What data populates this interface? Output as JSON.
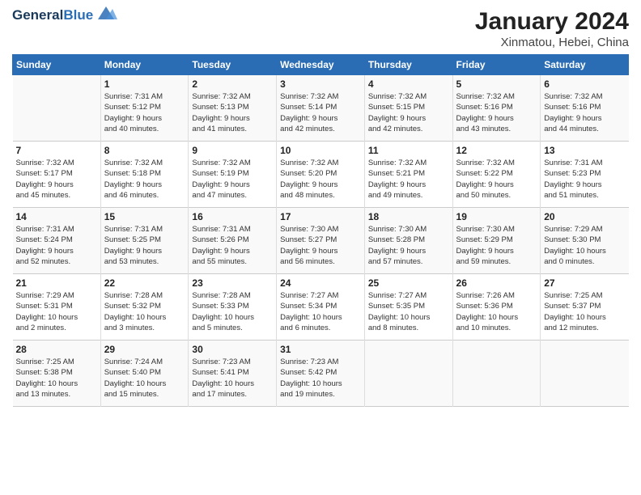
{
  "header": {
    "logo_line1": "General",
    "logo_line2": "Blue",
    "title": "January 2024",
    "subtitle": "Xinmatou, Hebei, China"
  },
  "columns": [
    "Sunday",
    "Monday",
    "Tuesday",
    "Wednesday",
    "Thursday",
    "Friday",
    "Saturday"
  ],
  "weeks": [
    [
      {
        "day": "",
        "info": ""
      },
      {
        "day": "1",
        "info": "Sunrise: 7:31 AM\nSunset: 5:12 PM\nDaylight: 9 hours\nand 40 minutes."
      },
      {
        "day": "2",
        "info": "Sunrise: 7:32 AM\nSunset: 5:13 PM\nDaylight: 9 hours\nand 41 minutes."
      },
      {
        "day": "3",
        "info": "Sunrise: 7:32 AM\nSunset: 5:14 PM\nDaylight: 9 hours\nand 42 minutes."
      },
      {
        "day": "4",
        "info": "Sunrise: 7:32 AM\nSunset: 5:15 PM\nDaylight: 9 hours\nand 42 minutes."
      },
      {
        "day": "5",
        "info": "Sunrise: 7:32 AM\nSunset: 5:16 PM\nDaylight: 9 hours\nand 43 minutes."
      },
      {
        "day": "6",
        "info": "Sunrise: 7:32 AM\nSunset: 5:16 PM\nDaylight: 9 hours\nand 44 minutes."
      }
    ],
    [
      {
        "day": "7",
        "info": "Sunrise: 7:32 AM\nSunset: 5:17 PM\nDaylight: 9 hours\nand 45 minutes."
      },
      {
        "day": "8",
        "info": "Sunrise: 7:32 AM\nSunset: 5:18 PM\nDaylight: 9 hours\nand 46 minutes."
      },
      {
        "day": "9",
        "info": "Sunrise: 7:32 AM\nSunset: 5:19 PM\nDaylight: 9 hours\nand 47 minutes."
      },
      {
        "day": "10",
        "info": "Sunrise: 7:32 AM\nSunset: 5:20 PM\nDaylight: 9 hours\nand 48 minutes."
      },
      {
        "day": "11",
        "info": "Sunrise: 7:32 AM\nSunset: 5:21 PM\nDaylight: 9 hours\nand 49 minutes."
      },
      {
        "day": "12",
        "info": "Sunrise: 7:32 AM\nSunset: 5:22 PM\nDaylight: 9 hours\nand 50 minutes."
      },
      {
        "day": "13",
        "info": "Sunrise: 7:31 AM\nSunset: 5:23 PM\nDaylight: 9 hours\nand 51 minutes."
      }
    ],
    [
      {
        "day": "14",
        "info": "Sunrise: 7:31 AM\nSunset: 5:24 PM\nDaylight: 9 hours\nand 52 minutes."
      },
      {
        "day": "15",
        "info": "Sunrise: 7:31 AM\nSunset: 5:25 PM\nDaylight: 9 hours\nand 53 minutes."
      },
      {
        "day": "16",
        "info": "Sunrise: 7:31 AM\nSunset: 5:26 PM\nDaylight: 9 hours\nand 55 minutes."
      },
      {
        "day": "17",
        "info": "Sunrise: 7:30 AM\nSunset: 5:27 PM\nDaylight: 9 hours\nand 56 minutes."
      },
      {
        "day": "18",
        "info": "Sunrise: 7:30 AM\nSunset: 5:28 PM\nDaylight: 9 hours\nand 57 minutes."
      },
      {
        "day": "19",
        "info": "Sunrise: 7:30 AM\nSunset: 5:29 PM\nDaylight: 9 hours\nand 59 minutes."
      },
      {
        "day": "20",
        "info": "Sunrise: 7:29 AM\nSunset: 5:30 PM\nDaylight: 10 hours\nand 0 minutes."
      }
    ],
    [
      {
        "day": "21",
        "info": "Sunrise: 7:29 AM\nSunset: 5:31 PM\nDaylight: 10 hours\nand 2 minutes."
      },
      {
        "day": "22",
        "info": "Sunrise: 7:28 AM\nSunset: 5:32 PM\nDaylight: 10 hours\nand 3 minutes."
      },
      {
        "day": "23",
        "info": "Sunrise: 7:28 AM\nSunset: 5:33 PM\nDaylight: 10 hours\nand 5 minutes."
      },
      {
        "day": "24",
        "info": "Sunrise: 7:27 AM\nSunset: 5:34 PM\nDaylight: 10 hours\nand 6 minutes."
      },
      {
        "day": "25",
        "info": "Sunrise: 7:27 AM\nSunset: 5:35 PM\nDaylight: 10 hours\nand 8 minutes."
      },
      {
        "day": "26",
        "info": "Sunrise: 7:26 AM\nSunset: 5:36 PM\nDaylight: 10 hours\nand 10 minutes."
      },
      {
        "day": "27",
        "info": "Sunrise: 7:25 AM\nSunset: 5:37 PM\nDaylight: 10 hours\nand 12 minutes."
      }
    ],
    [
      {
        "day": "28",
        "info": "Sunrise: 7:25 AM\nSunset: 5:38 PM\nDaylight: 10 hours\nand 13 minutes."
      },
      {
        "day": "29",
        "info": "Sunrise: 7:24 AM\nSunset: 5:40 PM\nDaylight: 10 hours\nand 15 minutes."
      },
      {
        "day": "30",
        "info": "Sunrise: 7:23 AM\nSunset: 5:41 PM\nDaylight: 10 hours\nand 17 minutes."
      },
      {
        "day": "31",
        "info": "Sunrise: 7:23 AM\nSunset: 5:42 PM\nDaylight: 10 hours\nand 19 minutes."
      },
      {
        "day": "",
        "info": ""
      },
      {
        "day": "",
        "info": ""
      },
      {
        "day": "",
        "info": ""
      }
    ]
  ]
}
